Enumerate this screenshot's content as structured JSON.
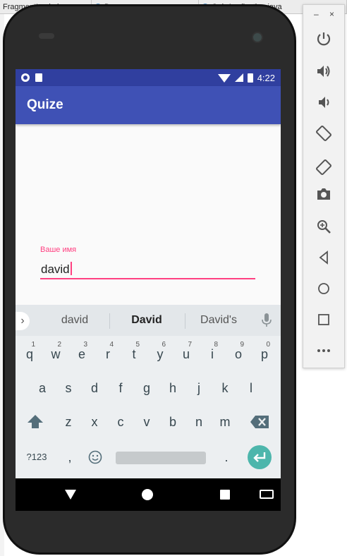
{
  "ide": {
    "tabs": [
      {
        "label": "FragmentLogin.java"
      },
      {
        "label": "Da"
      },
      {
        "label": "QuizApplication.java"
      }
    ]
  },
  "statusbar": {
    "time": "4:22"
  },
  "app": {
    "title": "Quize"
  },
  "form": {
    "label": "Ваше имя",
    "value": "david"
  },
  "keyboard": {
    "suggestions": [
      "david",
      "David",
      "David's"
    ],
    "row1": [
      {
        "key": "q",
        "hint": "1"
      },
      {
        "key": "w",
        "hint": "2"
      },
      {
        "key": "e",
        "hint": "3"
      },
      {
        "key": "r",
        "hint": "4"
      },
      {
        "key": "t",
        "hint": "5"
      },
      {
        "key": "y",
        "hint": "6"
      },
      {
        "key": "u",
        "hint": "7"
      },
      {
        "key": "i",
        "hint": "8"
      },
      {
        "key": "o",
        "hint": "9"
      },
      {
        "key": "p",
        "hint": "0"
      }
    ],
    "row2": [
      "a",
      "s",
      "d",
      "f",
      "g",
      "h",
      "j",
      "k",
      "l"
    ],
    "row3": [
      "z",
      "x",
      "c",
      "v",
      "b",
      "n",
      "m"
    ],
    "symbols_label": "?123",
    "comma": ",",
    "period": "."
  },
  "colors": {
    "primary": "#3f51b5",
    "primary_dark": "#303f9f",
    "accent": "#ff4081",
    "enter": "#4db6ac"
  },
  "emulator_toolbar": {
    "buttons": [
      "power-icon",
      "volume-up-icon",
      "volume-down-icon",
      "rotate-left-icon",
      "rotate-right-icon",
      "camera-icon",
      "zoom-icon",
      "back-icon",
      "home-icon",
      "overview-icon",
      "more-icon"
    ],
    "minimize": "–",
    "close": "×"
  }
}
